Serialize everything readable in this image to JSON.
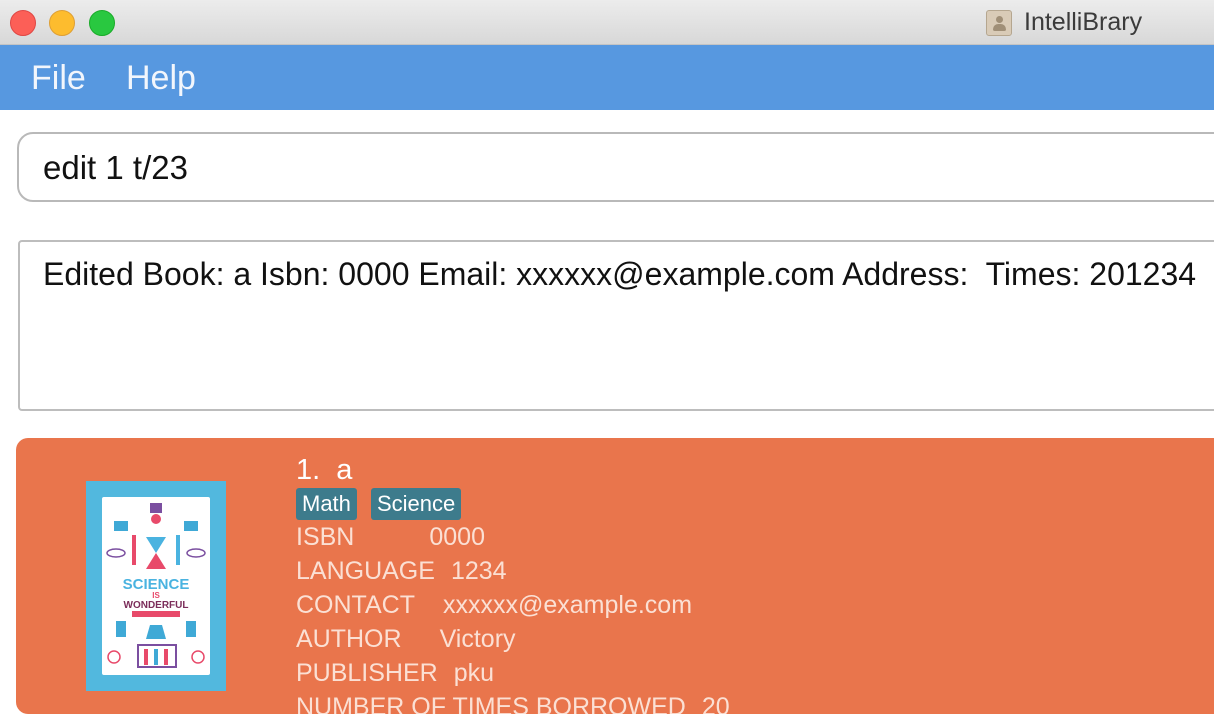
{
  "window": {
    "title": "IntelliBrary",
    "app_icon": "contacts-app-icon"
  },
  "menu": {
    "items": [
      "File",
      "Help"
    ]
  },
  "command": {
    "value": "edit 1 t/23"
  },
  "result": {
    "text": "Edited Book: a Isbn: 0000 Email: xxxxxx@example.com Address:  Times: 201234"
  },
  "book": {
    "index_title": "1.  a",
    "tags": [
      "Math",
      "Science"
    ],
    "cover": {
      "line1": "SCIENCE",
      "line2": "IS",
      "line3": "WONDERFUL"
    },
    "fields": [
      {
        "label": "ISBN",
        "value": "0000"
      },
      {
        "label": "LANGUAGE",
        "value": "1234"
      },
      {
        "label": "CONTACT",
        "value": "xxxxxx@example.com"
      },
      {
        "label": "AUTHOR",
        "value": "Victory"
      },
      {
        "label": "PUBLISHER",
        "value": "pku"
      },
      {
        "label": "NUMBER OF TIMES BORROWED",
        "value": "20"
      }
    ]
  },
  "colors": {
    "menu_bar": "#5798e0",
    "card": "#e9754c",
    "tag": "#3d7b8c"
  }
}
